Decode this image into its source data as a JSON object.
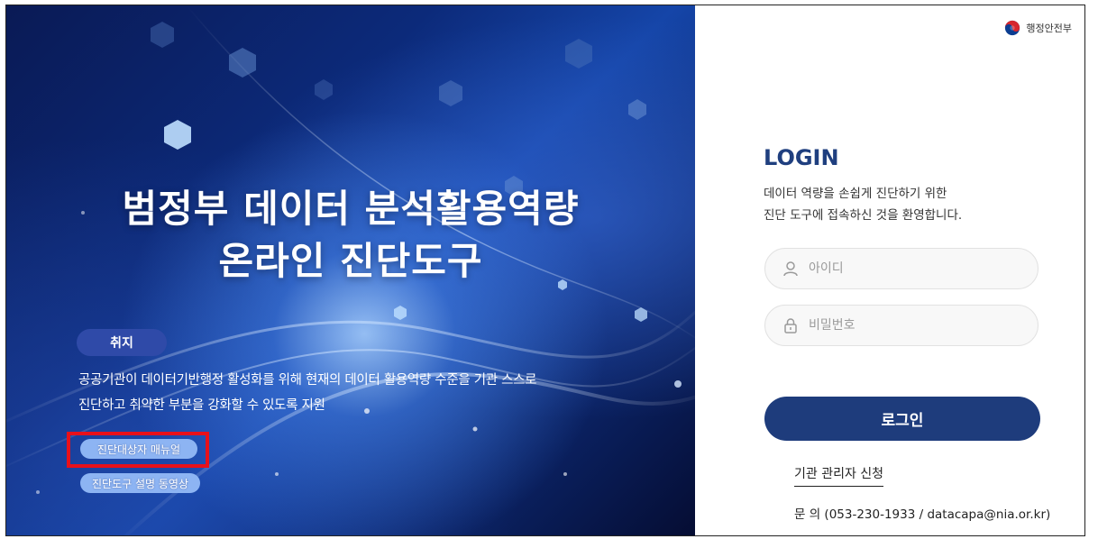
{
  "hero": {
    "title_line1": "범정부 데이터 분석활용역량",
    "title_line2": "온라인 진단도구",
    "purpose_badge": "취지",
    "purpose_line1": "공공기관이 데이터기반행정 활성화를 위해 현재의 데이터 활용역량 수준을 기관 스스로",
    "purpose_line2": "진단하고 취약한 부분을 강화할 수 있도록 지원",
    "manual_button": "진단대상자 매뉴얼",
    "video_button": "진단도구 설명 동영상"
  },
  "header": {
    "gov_name": "행정안전부",
    "gov_logo_icon": "taegeuk-logo-icon"
  },
  "login": {
    "title": "LOGIN",
    "welcome_line1": "데이터 역량을 손쉽게 진단하기 위한",
    "welcome_line2": "진단 도구에 접속하신 것을 환영합니다.",
    "id_placeholder": "아이디",
    "id_value": "",
    "password_placeholder": "비밀번호",
    "password_value": "",
    "login_button": "로그인",
    "admin_apply_link": "기관 관리자 신청",
    "contact": "문 의 (053-230-1933 / datacapa@nia.or.kr)"
  },
  "colors": {
    "brand_navy": "#1e3c7c",
    "badge_blue": "#2f4aa8",
    "pill_blue": "#8db4f3",
    "highlight_red": "#e8101a"
  }
}
